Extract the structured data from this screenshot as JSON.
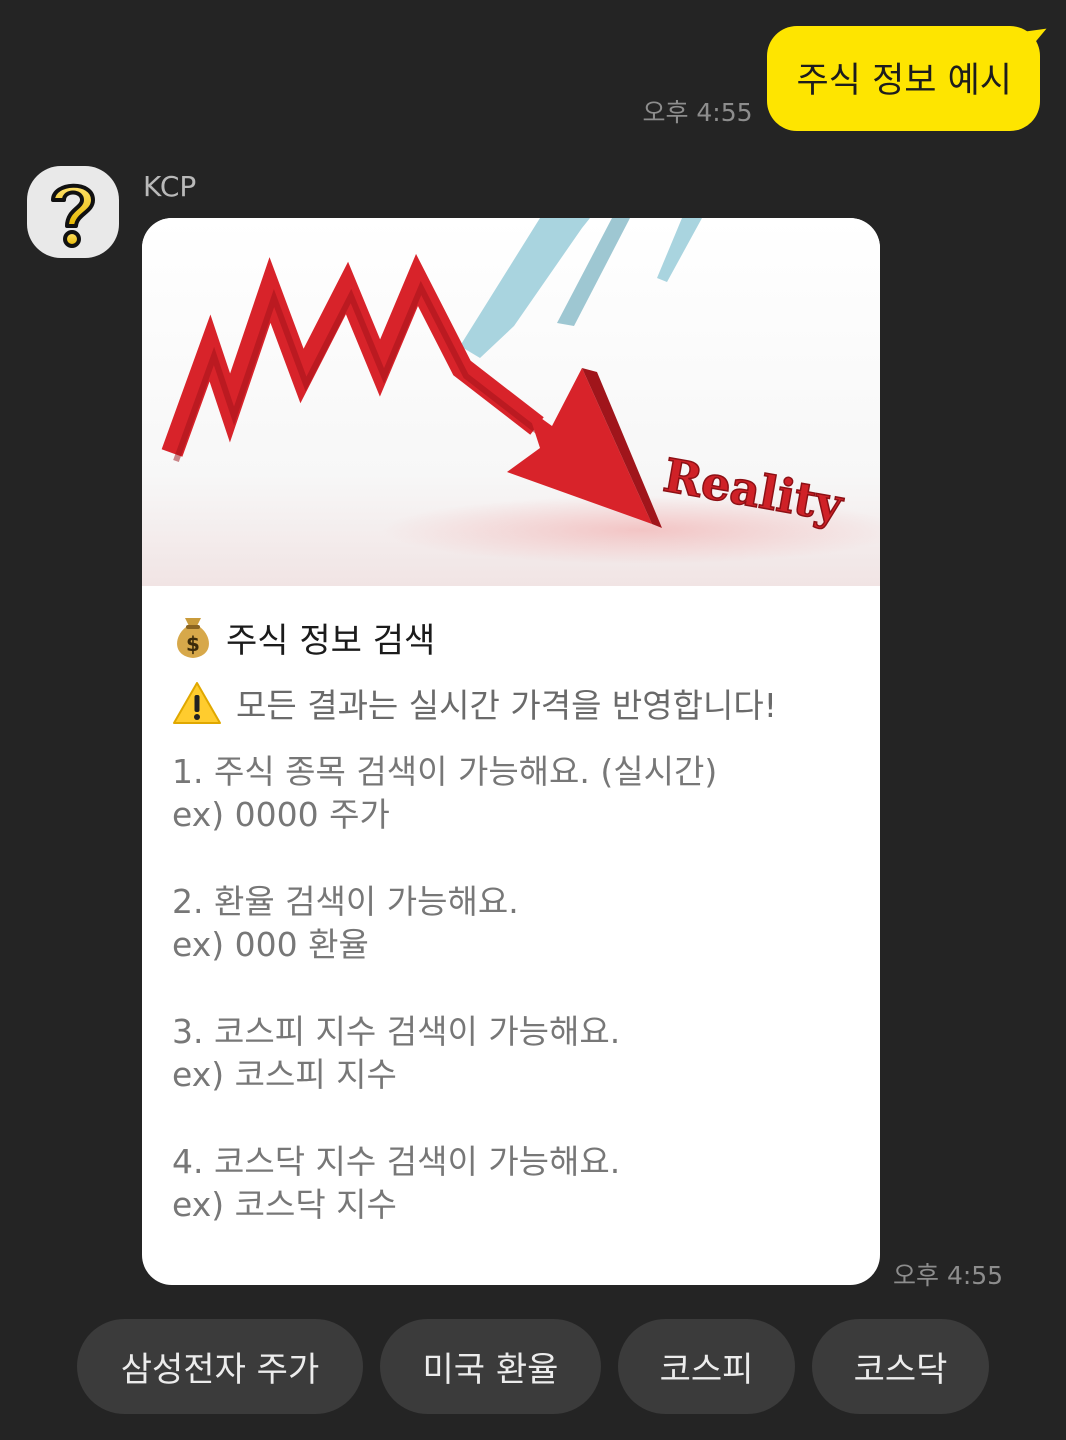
{
  "outgoing": {
    "message": "주식 정보 예시",
    "time": "오후 4:55"
  },
  "bot": {
    "name": "KCP",
    "avatar_icon": "question-mark-icon"
  },
  "card": {
    "image_caption": "Reality",
    "title_icon": "money-bag-icon",
    "title": "주식 정보 검색",
    "warning_icon": "warning-icon",
    "warning": "모든 결과는 실시간 가격을 반영합니다!",
    "items": [
      {
        "line1": "1. 주식 종목 검색이 가능해요. (실시간)",
        "line2": "ex) 0000 주가"
      },
      {
        "line1": "2. 환율 검색이 가능해요.",
        "line2": "ex) 000 환율"
      },
      {
        "line1": "3. 코스피 지수 검색이 가능해요.",
        "line2": "ex) 코스피 지수"
      },
      {
        "line1": "4. 코스닥 지수 검색이 가능해요.",
        "line2": "ex) 코스닥 지수"
      }
    ],
    "time": "오후 4:55"
  },
  "quick_replies": [
    "삼성전자 주가",
    "미국 환율",
    "코스피",
    "코스닥"
  ],
  "colors": {
    "background": "#242424",
    "outgoing_bubble": "#fee500",
    "chip": "#3b3b3b",
    "chart_red": "#d8232a",
    "chart_blue": "#a9d4df"
  }
}
